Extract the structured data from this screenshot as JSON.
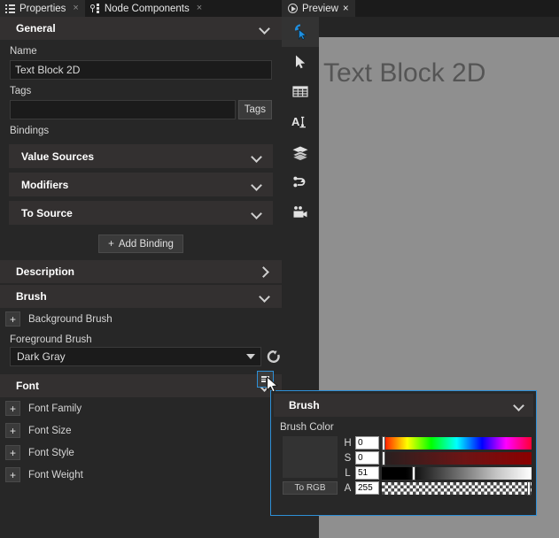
{
  "left_panel": {
    "tabs": [
      {
        "label": "Properties",
        "icon": "list-icon",
        "active": true,
        "close": "×"
      },
      {
        "label": "Node Components",
        "icon": "node-graph-icon",
        "active": false,
        "close": "×"
      }
    ],
    "general": {
      "header": "General",
      "name_label": "Name",
      "name_value": "Text Block 2D",
      "tags_label": "Tags",
      "tags_value": "",
      "tags_button": "Tags"
    },
    "bindings": {
      "label": "Bindings",
      "sections": [
        {
          "label": "Value Sources",
          "chevron": "chevron-down-icon"
        },
        {
          "label": "Modifiers",
          "chevron": "chevron-down-icon"
        },
        {
          "label": "To Source",
          "chevron": "chevron-down-icon"
        }
      ],
      "add_button": "Add Binding",
      "add_button_icon": "plus-icon"
    },
    "description": {
      "label": "Description",
      "chevron": "chevron-right-icon"
    },
    "brush": {
      "header": "Brush",
      "chevron": "chevron-down-icon",
      "background_brush_label": "Background Brush",
      "foreground_brush_label": "Foreground Brush",
      "foreground_value": "Dark Gray",
      "edit_icon": "document-edit-icon",
      "reset_icon": "reset-arrow-icon",
      "plus_icon": "plus-icon"
    },
    "font": {
      "header": "Font",
      "chevron": "chevron-down-icon",
      "rows": [
        {
          "label": "Font Family",
          "icon": "plus-icon"
        },
        {
          "label": "Font Size",
          "icon": "plus-icon"
        },
        {
          "label": "Font Style",
          "icon": "plus-icon"
        },
        {
          "label": "Font Weight",
          "icon": "plus-icon"
        }
      ]
    }
  },
  "preview": {
    "tab": {
      "label": "Preview",
      "icon": "play-circle-icon",
      "close": "×"
    },
    "toolbar": [
      {
        "name": "pointer-select-tool",
        "icon": "cursor-click-icon",
        "active": true
      },
      {
        "name": "arrow-tool",
        "icon": "arrow-pointer-icon",
        "active": false
      },
      {
        "name": "grid-tool",
        "icon": "table-grid-icon",
        "active": false
      },
      {
        "name": "text-tool",
        "icon": "text-format-icon",
        "active": false
      },
      {
        "name": "layers-tool",
        "icon": "layers-icon",
        "active": false
      },
      {
        "name": "graph-tool",
        "icon": "node-link-icon",
        "active": false
      },
      {
        "name": "camera-tool",
        "icon": "video-camera-icon",
        "active": false
      }
    ],
    "canvas_text": "Text Block 2D",
    "canvas_bg": "#8f8f8f",
    "canvas_text_color": "#555555"
  },
  "brush_popup": {
    "header": "Brush",
    "chevron": "chevron-down-icon",
    "color_label": "Brush Color",
    "to_rgb_button": "To RGB",
    "swatch_color": "#333333",
    "channels": [
      {
        "letter": "H",
        "value": "0",
        "track": "hue",
        "thumb_pct": 0
      },
      {
        "letter": "S",
        "value": "0",
        "track": "saturation",
        "thumb_pct": 0
      },
      {
        "letter": "L",
        "value": "51",
        "track": "lightness",
        "thumb_pct": 20
      },
      {
        "letter": "A",
        "value": "255",
        "track": "alpha",
        "thumb_pct": 100
      }
    ],
    "accent_color": "#2e8fd6"
  }
}
